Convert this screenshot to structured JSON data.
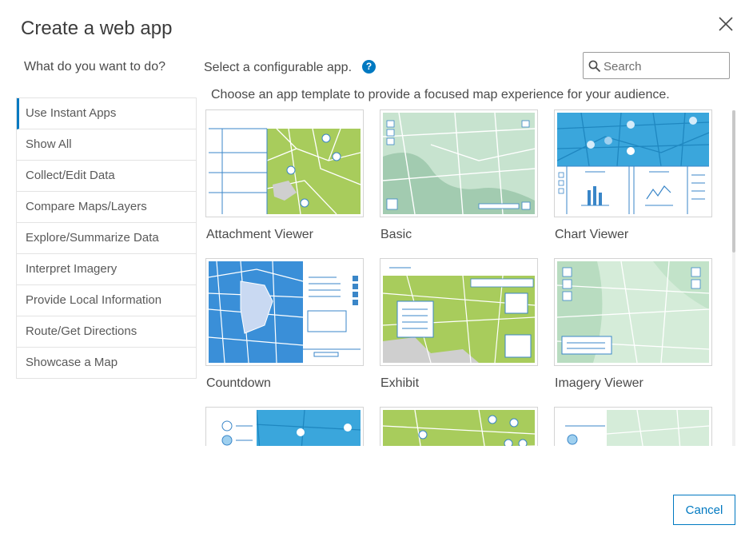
{
  "dialog": {
    "title": "Create a web app",
    "question": "What do you want to do?",
    "select_label": "Select a configurable app.",
    "help_glyph": "?",
    "description": "Choose an app template to provide a focused map experience for your audience.",
    "cancel_label": "Cancel"
  },
  "search": {
    "placeholder": "Search",
    "value": ""
  },
  "sidebar": {
    "items": [
      {
        "label": "Use Instant Apps",
        "active": true
      },
      {
        "label": "Show All"
      },
      {
        "label": "Collect/Edit Data"
      },
      {
        "label": "Compare Maps/Layers"
      },
      {
        "label": "Explore/Summarize Data"
      },
      {
        "label": "Interpret Imagery"
      },
      {
        "label": "Provide Local Information"
      },
      {
        "label": "Route/Get Directions"
      },
      {
        "label": "Showcase a Map"
      }
    ]
  },
  "templates": [
    {
      "label": "Attachment Viewer"
    },
    {
      "label": "Basic"
    },
    {
      "label": "Chart Viewer"
    },
    {
      "label": "Countdown"
    },
    {
      "label": "Exhibit"
    },
    {
      "label": "Imagery Viewer"
    }
  ],
  "colors": {
    "accent": "#0079c1",
    "map_green": "#a8cc5c",
    "map_blue": "#3aa6dc",
    "map_pale": "#c7e3cf"
  },
  "icons": {
    "close": "close-icon",
    "search": "search-icon",
    "help": "help-icon"
  }
}
